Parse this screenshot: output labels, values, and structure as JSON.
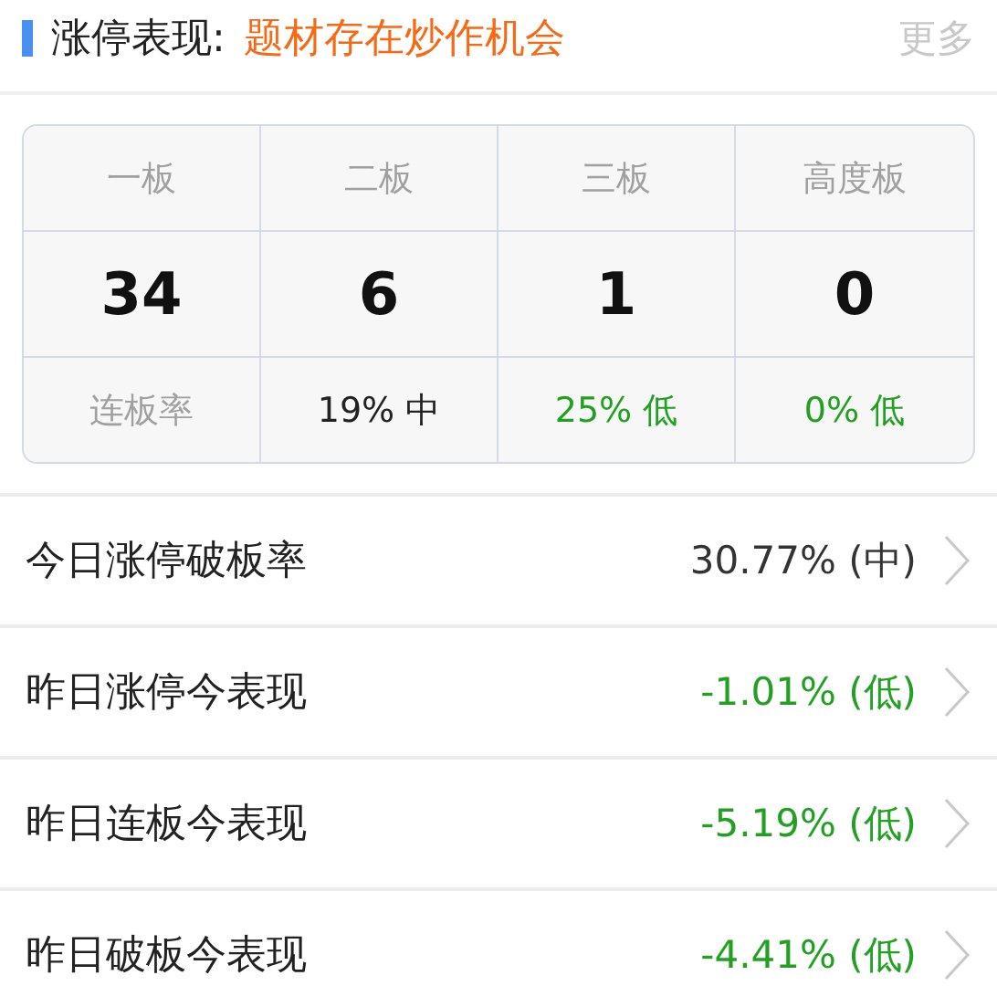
{
  "header": {
    "title": "涨停表现:",
    "headline": "题材存在炒作机会",
    "more": "更多"
  },
  "board_table": {
    "columns": [
      "一板",
      "二板",
      "三板",
      "高度板"
    ],
    "counts": [
      "34",
      "6",
      "1",
      "0"
    ],
    "rate_label": "连板率",
    "rates": [
      {
        "text": "19% 中",
        "color": "#222222"
      },
      {
        "text": "25% 低",
        "color": "#22a022"
      },
      {
        "text": "0% 低",
        "color": "#22a022"
      }
    ]
  },
  "rows": [
    {
      "label": "今日涨停破板率",
      "value": "30.77% (中)",
      "color": "#333333"
    },
    {
      "label": "昨日涨停今表现",
      "value": "-1.01% (低)",
      "color": "#22a022"
    },
    {
      "label": "昨日连板今表现",
      "value": "-5.19% (低)",
      "color": "#22a022"
    },
    {
      "label": "昨日破板今表现",
      "value": "-4.41% (低)",
      "color": "#22a022"
    }
  ]
}
